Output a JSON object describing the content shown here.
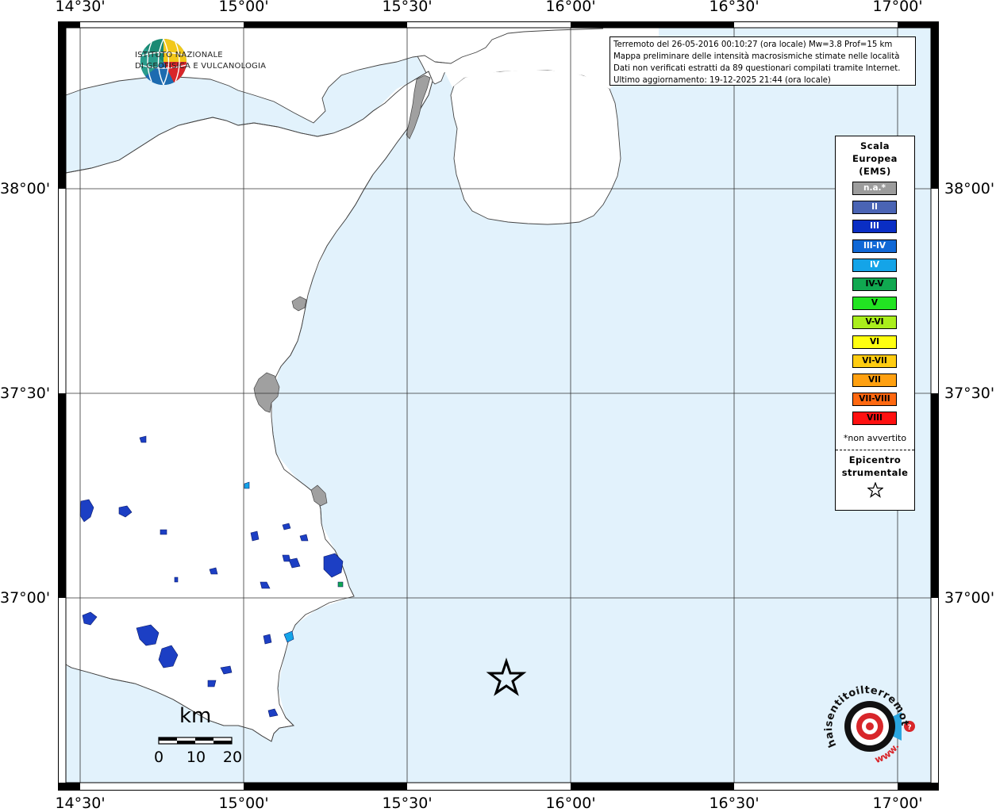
{
  "map": {
    "ticks_top": [
      "14°30'",
      "15°00'",
      "15°30'",
      "16°00'",
      "16°30'",
      "17°00'"
    ],
    "ticks_bottom": [
      "14°30'",
      "15°00'",
      "15°30'",
      "16°00'",
      "16°30'",
      "17°00'"
    ],
    "ticks_left": [
      "38°00'",
      "37°30'",
      "37°00'"
    ],
    "ticks_right": [
      "38°00'",
      "37°30'",
      "37°00'"
    ],
    "colors": {
      "sea": "#e2f2fc",
      "land": "#ffffff",
      "urban": "#a0a0a0",
      "intensity_iii": "#1c3fc4"
    }
  },
  "info": {
    "line1": "Terremoto del 26-05-2016 00:10:27 (ora locale) Mw=3.8 Prof=15 km",
    "line2": "Mappa preliminare delle intensità macrosismiche stimate nelle località",
    "line3": "Dati non verificati estratti da 89 questionari compilati tramite Internet.",
    "line4": "Ultimo aggiornamento: 19-12-2025 21:44 (ora locale)"
  },
  "legend": {
    "title_line1": "Scala",
    "title_line2": "Europea",
    "title_line3": "(EMS)",
    "items": [
      {
        "label": "n.a.*",
        "color": "#9c9c9c",
        "text_color": "#ffffff"
      },
      {
        "label": "II",
        "color": "#4a64b4",
        "text_color": "#ffffff"
      },
      {
        "label": "III",
        "color": "#0a2ec4",
        "text_color": "#ffffff"
      },
      {
        "label": "III-IV",
        "color": "#1068d6",
        "text_color": "#ffffff"
      },
      {
        "label": "IV",
        "color": "#14a4e8",
        "text_color": "#ffffff"
      },
      {
        "label": "IV-V",
        "color": "#10a850",
        "text_color": "#000000"
      },
      {
        "label": "V",
        "color": "#22e422",
        "text_color": "#000000"
      },
      {
        "label": "V-VI",
        "color": "#aaee1c",
        "text_color": "#000000"
      },
      {
        "label": "VI",
        "color": "#ffff10",
        "text_color": "#000000"
      },
      {
        "label": "VI-VII",
        "color": "#ffcc10",
        "text_color": "#000000"
      },
      {
        "label": "VII",
        "color": "#ffa010",
        "text_color": "#000000"
      },
      {
        "label": "VII-VIII",
        "color": "#ff6810",
        "text_color": "#000000"
      },
      {
        "label": "VIII",
        "color": "#ff1010",
        "text_color": "#000000"
      }
    ],
    "note": "*non avvertito",
    "epi_line1": "Epicentro",
    "epi_line2": "strumentale"
  },
  "ingv": {
    "line1": "ISTITUTO NAZIONALE",
    "line2": "DI GEOFISICA E VULCANOLOGIA"
  },
  "scale": {
    "unit": "km",
    "labels": [
      "0",
      "10",
      "20"
    ]
  },
  "hsit": {
    "text": "haisentitoilterremoto.it",
    "www": "www."
  }
}
